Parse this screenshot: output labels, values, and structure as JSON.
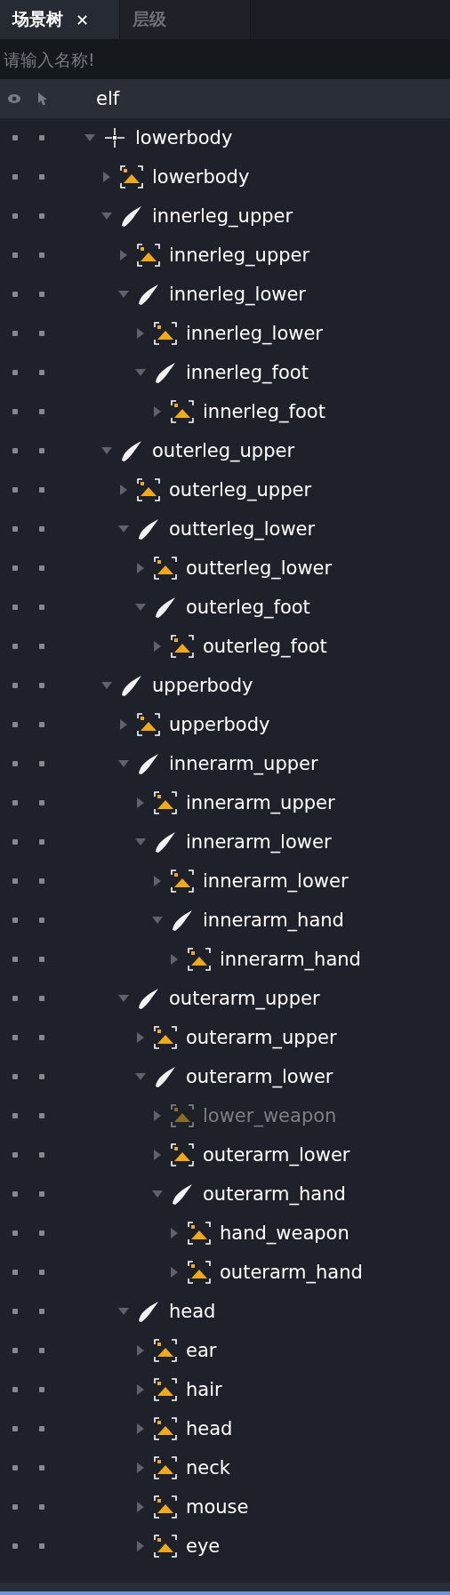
{
  "tabs": [
    {
      "label": "场景树",
      "selected": true,
      "close": "✕"
    },
    {
      "label": "层级",
      "selected": false
    }
  ],
  "search": {
    "placeholder": "请输入名称!"
  },
  "root": {
    "name": "elf",
    "selected": true
  },
  "tree": [
    {
      "name": "lowerbody",
      "kind": "node",
      "expanded": true,
      "children": [
        {
          "name": "lowerbody",
          "kind": "sprite",
          "expanded": false
        },
        {
          "name": "innerleg_upper",
          "kind": "bone",
          "expanded": true,
          "children": [
            {
              "name": "innerleg_upper",
              "kind": "sprite",
              "expanded": false
            },
            {
              "name": "innerleg_lower",
              "kind": "bone",
              "expanded": true,
              "children": [
                {
                  "name": "innerleg_lower",
                  "kind": "sprite",
                  "expanded": false
                },
                {
                  "name": "innerleg_foot",
                  "kind": "bone",
                  "expanded": true,
                  "children": [
                    {
                      "name": "innerleg_foot",
                      "kind": "sprite",
                      "expanded": false
                    }
                  ]
                }
              ]
            }
          ]
        },
        {
          "name": "outerleg_upper",
          "kind": "bone",
          "expanded": true,
          "children": [
            {
              "name": "outerleg_upper",
              "kind": "sprite",
              "expanded": false
            },
            {
              "name": "outterleg_lower",
              "kind": "bone",
              "expanded": true,
              "children": [
                {
                  "name": "outterleg_lower",
                  "kind": "sprite",
                  "expanded": false
                },
                {
                  "name": "outerleg_foot",
                  "kind": "bone",
                  "expanded": true,
                  "children": [
                    {
                      "name": "outerleg_foot",
                      "kind": "sprite",
                      "expanded": false
                    }
                  ]
                }
              ]
            }
          ]
        },
        {
          "name": "upperbody",
          "kind": "bone",
          "expanded": true,
          "children": [
            {
              "name": "upperbody",
              "kind": "sprite",
              "expanded": false
            },
            {
              "name": "innerarm_upper",
              "kind": "bone",
              "expanded": true,
              "children": [
                {
                  "name": "innerarm_upper",
                  "kind": "sprite",
                  "expanded": false
                },
                {
                  "name": "innerarm_lower",
                  "kind": "bone",
                  "expanded": true,
                  "children": [
                    {
                      "name": "innerarm_lower",
                      "kind": "sprite",
                      "expanded": false
                    },
                    {
                      "name": "innerarm_hand",
                      "kind": "bone",
                      "expanded": true,
                      "children": [
                        {
                          "name": "innerarm_hand",
                          "kind": "sprite",
                          "expanded": false
                        }
                      ]
                    }
                  ]
                }
              ]
            },
            {
              "name": "outerarm_upper",
              "kind": "bone",
              "expanded": true,
              "children": [
                {
                  "name": "outerarm_upper",
                  "kind": "sprite",
                  "expanded": false
                },
                {
                  "name": "outerarm_lower",
                  "kind": "bone",
                  "expanded": true,
                  "children": [
                    {
                      "name": "lower_weapon",
                      "kind": "sprite",
                      "expanded": false,
                      "disabled": true
                    },
                    {
                      "name": "outerarm_lower",
                      "kind": "sprite",
                      "expanded": false
                    },
                    {
                      "name": "outerarm_hand",
                      "kind": "bone",
                      "expanded": true,
                      "children": [
                        {
                          "name": "hand_weapon",
                          "kind": "sprite",
                          "expanded": false
                        },
                        {
                          "name": "outerarm_hand",
                          "kind": "sprite",
                          "expanded": false
                        }
                      ]
                    }
                  ]
                }
              ]
            },
            {
              "name": "head",
              "kind": "bone",
              "expanded": true,
              "children": [
                {
                  "name": "ear",
                  "kind": "sprite",
                  "expanded": false
                },
                {
                  "name": "hair",
                  "kind": "sprite",
                  "expanded": false
                },
                {
                  "name": "head",
                  "kind": "sprite",
                  "expanded": false
                },
                {
                  "name": "neck",
                  "kind": "sprite",
                  "expanded": false
                },
                {
                  "name": "mouse",
                  "kind": "sprite",
                  "expanded": false
                },
                {
                  "name": "eye",
                  "kind": "sprite",
                  "expanded": false
                }
              ]
            }
          ]
        }
      ]
    }
  ]
}
